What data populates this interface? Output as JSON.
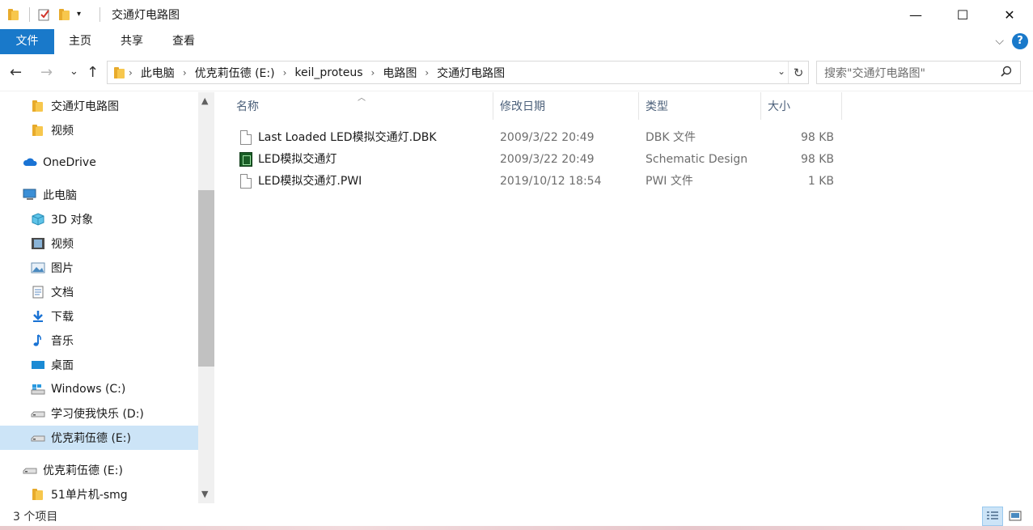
{
  "window": {
    "title": "交通灯电路图",
    "controls": {
      "minimize": "—",
      "maximize": "☐",
      "close": "✕"
    }
  },
  "ribbon": {
    "tabs": [
      {
        "label": "文件"
      },
      {
        "label": "主页"
      },
      {
        "label": "共享"
      },
      {
        "label": "查看"
      }
    ],
    "expand_glyph": "⌵",
    "help_glyph": "?"
  },
  "address": {
    "glyphs": {
      "back": "←",
      "forward": "→",
      "recent": "⌄",
      "up": "↑",
      "separator": "›",
      "dropdown": "⌄",
      "refresh": "↻"
    },
    "breadcrumb": [
      "此电脑",
      "优克莉伍德 (E:)",
      "keil_proteus",
      "电路图",
      "交通灯电路图"
    ]
  },
  "search": {
    "placeholder": "搜索\"交通灯电路图\"",
    "icon": "search-icon"
  },
  "navigation": {
    "items": [
      {
        "label": "交通灯电路图",
        "icon": "folder-icon"
      },
      {
        "label": "视频",
        "icon": "folder-icon"
      },
      {
        "label": "OneDrive",
        "icon": "cloud-icon"
      },
      {
        "label": "此电脑",
        "icon": "computer-icon"
      },
      {
        "label": "3D 对象",
        "icon": "cube-icon"
      },
      {
        "label": "视频",
        "icon": "video-icon"
      },
      {
        "label": "图片",
        "icon": "picture-icon"
      },
      {
        "label": "文档",
        "icon": "document-icon"
      },
      {
        "label": "下载",
        "icon": "download-icon"
      },
      {
        "label": "音乐",
        "icon": "music-icon"
      },
      {
        "label": "桌面",
        "icon": "desktop-icon"
      },
      {
        "label": "Windows (C:)",
        "icon": "windows-drive-icon"
      },
      {
        "label": "学习使我快乐 (D:)",
        "icon": "drive-icon"
      },
      {
        "label": "优克莉伍德 (E:)",
        "icon": "drive-icon",
        "selected": true
      },
      {
        "label": "优克莉伍德 (E:)",
        "icon": "drive-icon"
      },
      {
        "label": "51单片机-smg",
        "icon": "folder-icon"
      }
    ]
  },
  "columns": [
    "名称",
    "修改日期",
    "类型",
    "大小"
  ],
  "files": [
    {
      "name": "Last Loaded LED模拟交通灯.DBK",
      "date": "2009/3/22 20:49",
      "type": "DBK 文件",
      "size": "98 KB",
      "icon": "generic-file-icon"
    },
    {
      "name": "LED模拟交通灯",
      "date": "2009/3/22 20:49",
      "type": "Schematic Design",
      "size": "98 KB",
      "icon": "schematic-file-icon"
    },
    {
      "name": "LED模拟交通灯.PWI",
      "date": "2019/10/12 18:54",
      "type": "PWI 文件",
      "size": "1 KB",
      "icon": "generic-file-icon"
    }
  ],
  "status": {
    "item_count": "3 个项目"
  }
}
